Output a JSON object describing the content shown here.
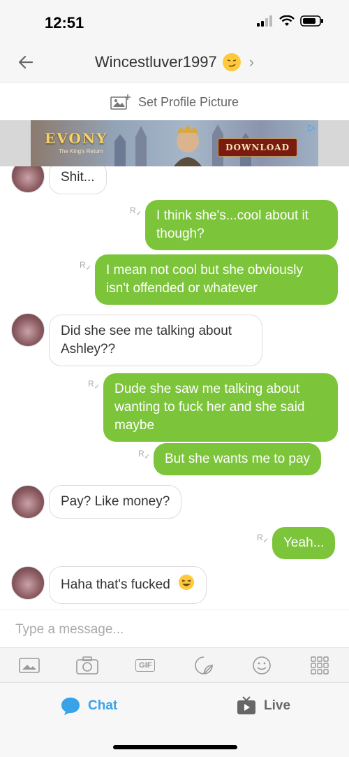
{
  "status": {
    "time": "12:51"
  },
  "header": {
    "contact_name": "Wincestluver1997",
    "title_emoji": "smirk-emoji"
  },
  "profile": {
    "set_picture_label": "Set Profile Picture"
  },
  "ad": {
    "brand": "EVONY",
    "tagline": "The King's Return",
    "download_label": "DOWNLOAD"
  },
  "messages": [
    {
      "from": "them",
      "text": "Shit..."
    },
    {
      "from": "me",
      "text": "I think she's...cool about it though?"
    },
    {
      "from": "me",
      "text": "I mean not cool but she obviously isn't offended or whatever"
    },
    {
      "from": "them",
      "text": "Did she see me talking about Ashley??"
    },
    {
      "from": "me",
      "text": "Dude she saw me talking about wanting to fuck her and she said maybe"
    },
    {
      "from": "me",
      "text": "But she wants me to pay"
    },
    {
      "from": "them",
      "text": "Pay? Like money?"
    },
    {
      "from": "me",
      "text": "Yeah..."
    },
    {
      "from": "them",
      "text": "Haha that's fucked",
      "emoji": "laughing-emoji"
    }
  ],
  "composer": {
    "placeholder": "Type a message..."
  },
  "tools": {
    "gif_label": "GIF"
  },
  "tabs": {
    "chat_label": "Chat",
    "live_label": "Live"
  },
  "colors": {
    "sent_bubble": "#7cc43a",
    "accent": "#39a3e8",
    "read_mark": "R"
  }
}
